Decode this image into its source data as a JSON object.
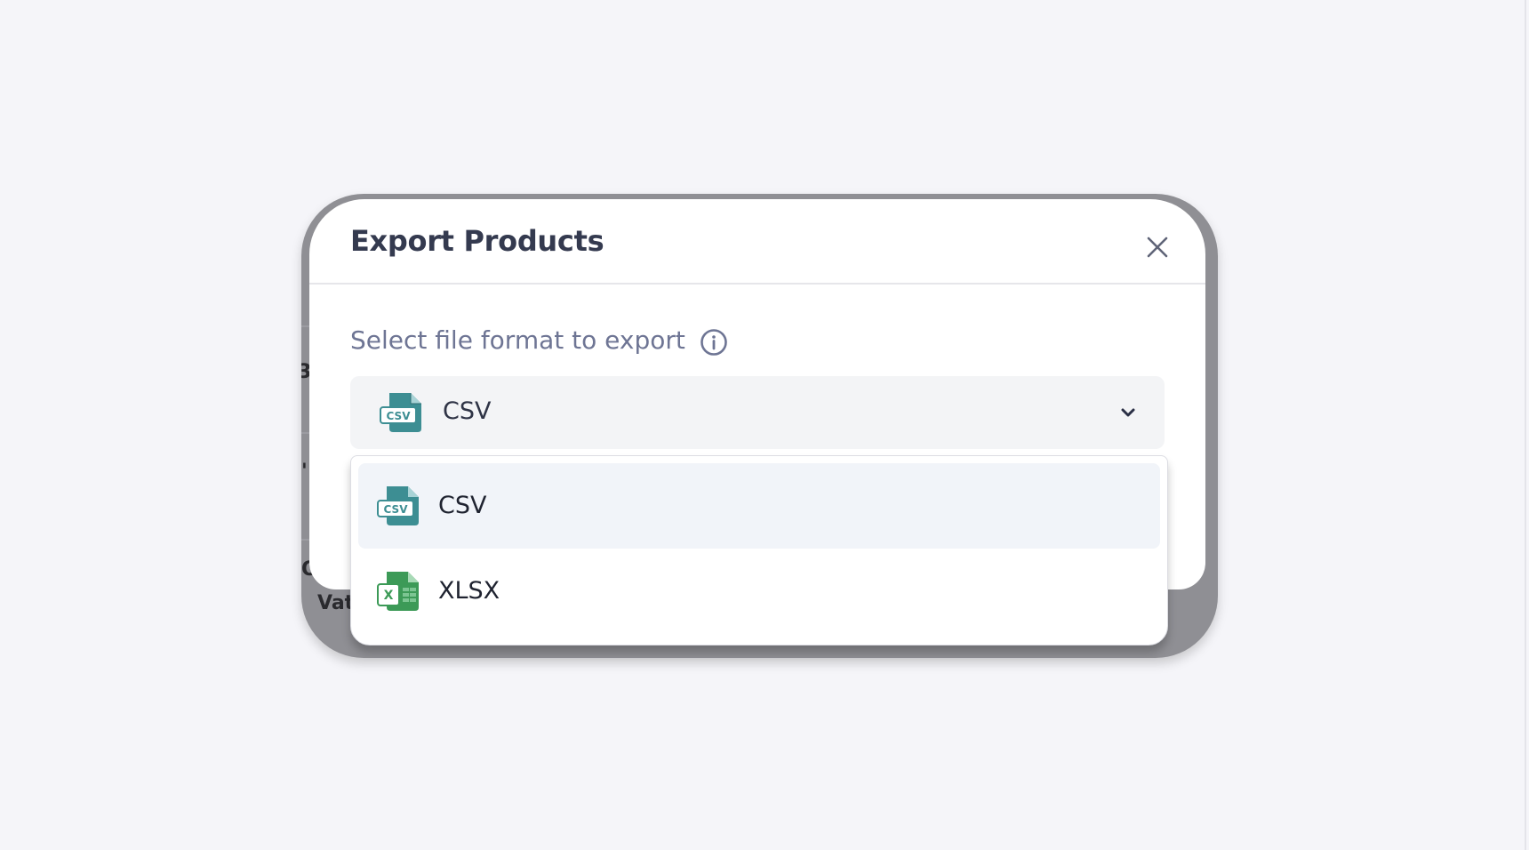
{
  "modal": {
    "title": "Export Products",
    "close_label": "close",
    "field_label": "Select file format to export",
    "selected_value": "CSV",
    "options": [
      {
        "label": "CSV",
        "icon": "csv-file-icon",
        "selected": true
      },
      {
        "label": "XLSX",
        "icon": "xlsx-file-icon",
        "selected": false
      }
    ]
  },
  "underlay": {
    "fragments": [
      "3",
      "'",
      "O",
      "Vat"
    ]
  },
  "colors": {
    "title": "#343a4f",
    "label": "#6e7594",
    "csv_icon": "#3d8e93",
    "xlsx_icon": "#3c9a57",
    "selected_option_bg": "#f1f4f9",
    "select_bg": "#f3f4f6"
  }
}
